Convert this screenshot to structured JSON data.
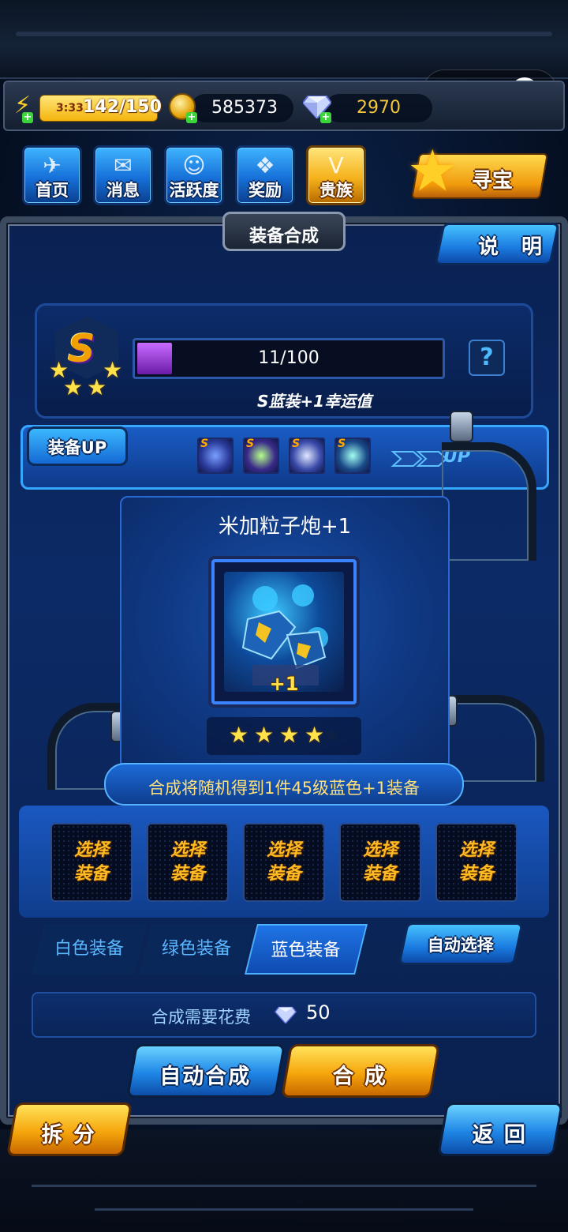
{
  "resources": {
    "energy_timer": "3:33",
    "energy": "142/150",
    "coins": "585373",
    "gems": "2970"
  },
  "nav": {
    "items": [
      {
        "label": "首页",
        "icon": "home-icon"
      },
      {
        "label": "消息",
        "icon": "mail-icon"
      },
      {
        "label": "活跃度",
        "icon": "smile-icon"
      },
      {
        "label": "奖励",
        "icon": "gift-icon"
      },
      {
        "label": "贵族",
        "icon": "noble-v-icon"
      }
    ],
    "treasure_label": "寻宝"
  },
  "panel": {
    "title": "装备合成",
    "help_label": "说 明"
  },
  "luck": {
    "grade": "S",
    "stars": 5,
    "progress_text": "11/100",
    "progress_fraction": 0.11,
    "note": "S蓝装+1幸运值",
    "help_symbol": "?"
  },
  "up_strip": {
    "tag": "装备UP",
    "mini_grade": "S",
    "up_label": "UP",
    "items_count": 4
  },
  "equipment": {
    "name": "米加粒子炮+1",
    "plus": "+1",
    "stars_filled": 4,
    "stars_total": 5
  },
  "hint": "合成将随机得到1件45级蓝色+1装备",
  "slots": [
    {
      "line1": "选择",
      "line2": "装备"
    },
    {
      "line1": "选择",
      "line2": "装备"
    },
    {
      "line1": "选择",
      "line2": "装备"
    },
    {
      "line1": "选择",
      "line2": "装备"
    },
    {
      "line1": "选择",
      "line2": "装备"
    }
  ],
  "tabs": [
    {
      "label": "白色装备",
      "active": false
    },
    {
      "label": "绿色装备",
      "active": false
    },
    {
      "label": "蓝色装备",
      "active": true
    }
  ],
  "auto_select_label": "自动选择",
  "cost": {
    "label": "合成需要花费",
    "value": "50"
  },
  "buttons": {
    "auto_merge": "自动合成",
    "merge": "合 成",
    "split": "拆 分",
    "back": "返 回"
  },
  "colors": {
    "accent_blue": "#1f86e6",
    "accent_gold": "#f6a60c",
    "luck_fill": "#9a3cd8"
  }
}
